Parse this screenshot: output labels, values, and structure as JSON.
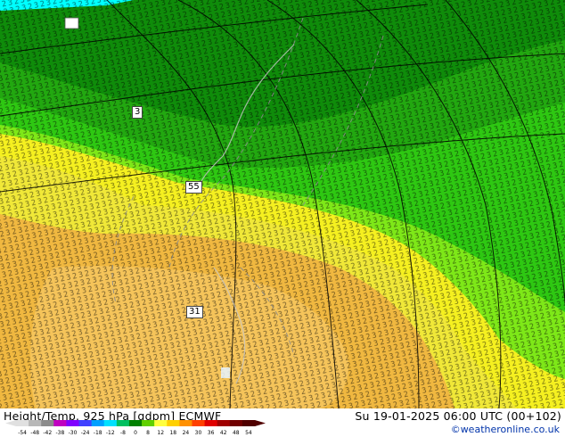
{
  "map": {
    "labels": [
      {
        "text": "3"
      },
      {
        "text": "55"
      },
      {
        "text": "31"
      }
    ]
  },
  "footer": {
    "title": "Height/Temp. 925 hPa [gdpm] ECMWF",
    "valid": "Su 19-01-2025 06:00 UTC (00+102)",
    "credit": "©weatheronline.co.uk"
  },
  "legend": {
    "ticks": [
      "-54",
      "-48",
      "-42",
      "-38",
      "-30",
      "-24",
      "-18",
      "-12",
      "-8",
      "0",
      "8",
      "12",
      "18",
      "24",
      "30",
      "36",
      "42",
      "48",
      "54"
    ],
    "colors": [
      "#e0e0e0",
      "#b8b8b8",
      "#8c8c8c",
      "#c000c0",
      "#8000ff",
      "#4040ff",
      "#00a0ff",
      "#00e0ff",
      "#00c060",
      "#008000",
      "#60d000",
      "#ffff40",
      "#ffd000",
      "#ff9000",
      "#ff4000",
      "#e00000",
      "#a00000",
      "#700000",
      "#500000"
    ]
  },
  "colors": {
    "dark_green": "#0f8c0a",
    "mid_green": "#22a810",
    "green": "#2ec812",
    "light_green": "#7ee818",
    "yellow": "#f5f020",
    "pale_yellow": "#f0e838",
    "orange": "#f0b840",
    "light_orange": "#f5c45a",
    "cyan": "#00ffff"
  }
}
